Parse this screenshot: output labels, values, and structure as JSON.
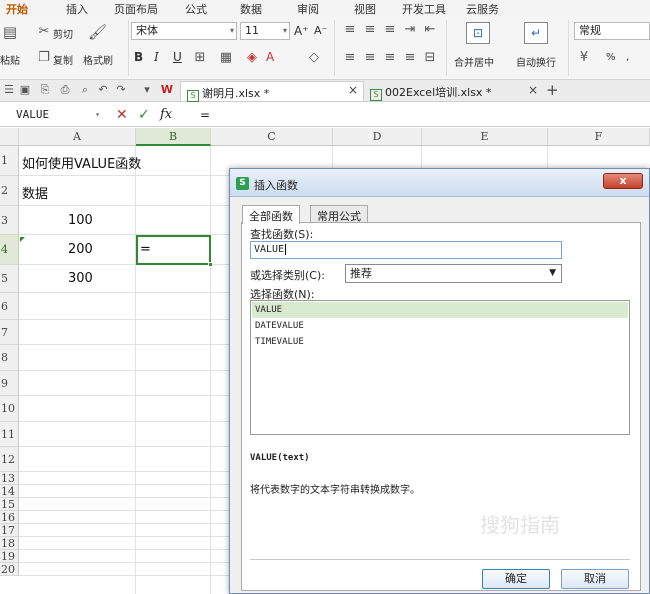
{
  "menu": {
    "tabs": [
      "开始",
      "插入",
      "页面布局",
      "公式",
      "数据",
      "审阅",
      "视图",
      "开发工具",
      "云服务"
    ]
  },
  "ribbon": {
    "paste_label": "粘贴",
    "cut_label": "剪切",
    "copy_label": "复制",
    "format_painter_label": "格式刷",
    "font_name": "宋体",
    "font_size": "11",
    "bold": "B",
    "italic": "I",
    "underline": "U",
    "merge_label": "合并居中",
    "wrap_label": "自动换行",
    "number_format": "常规",
    "percent": "%",
    "comma": ","
  },
  "doc_tabs": [
    {
      "name": "谢明月.xlsx *",
      "active": true
    },
    {
      "name": "002Excel培训.xlsx *",
      "active": false
    }
  ],
  "new_tab_symbol": "+",
  "formula_bar": {
    "name_box": "VALUE",
    "cancel": "✕",
    "confirm": "✓",
    "fx": "fx",
    "content": "="
  },
  "grid": {
    "columns": [
      "A",
      "B",
      "C",
      "D",
      "E",
      "F"
    ],
    "rows": [
      "1",
      "2",
      "3",
      "4",
      "5",
      "6",
      "7",
      "8",
      "9",
      "10",
      "11",
      "12",
      "13",
      "14",
      "15",
      "16",
      "17",
      "18",
      "19",
      "20"
    ],
    "cells": {
      "A1": "如何使用VALUE函数",
      "A2": "数据",
      "A3": "100",
      "A4": "200",
      "A5": "300",
      "B4": "="
    }
  },
  "dialog": {
    "title": "插入函数",
    "close": "x",
    "tabs": [
      "全部函数",
      "常用公式"
    ],
    "search_label": "查找函数(S):",
    "search_value": "VALUE",
    "category_label": "或选择类别(C):",
    "category_value": "推荐",
    "select_label": "选择函数(N):",
    "functions": [
      "VALUE",
      "DATEVALUE",
      "TIMEVALUE"
    ],
    "selected_function": "VALUE",
    "syntax": "VALUE(text)",
    "description": "将代表数字的文本字符串转换成数字。",
    "ok_label": "确定",
    "cancel_label": "取消",
    "watermark": "搜狗指南"
  },
  "colors": {
    "accent_green": "#2f8a2f",
    "active_tab": "#c05a00",
    "selection": "#d8ead0"
  }
}
